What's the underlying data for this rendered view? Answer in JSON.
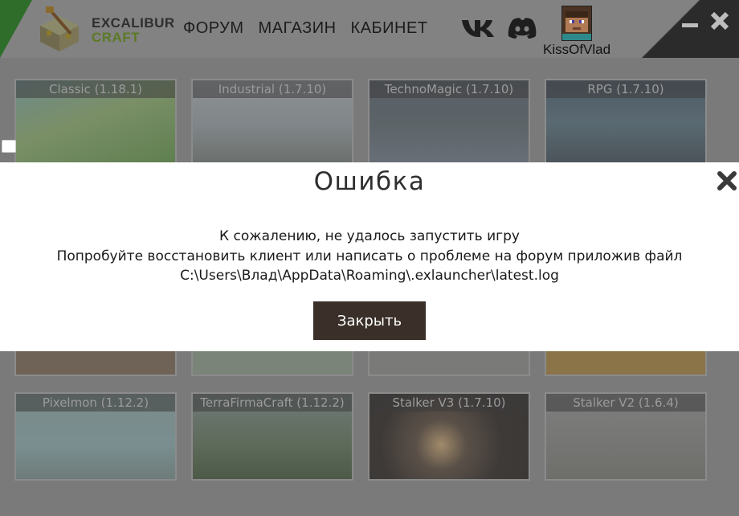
{
  "app": {
    "logo": {
      "line1": "EXCALIBUR",
      "line2": "CRAFT"
    },
    "nav": [
      "ФОРУМ",
      "МАГАЗИН",
      "КАБИНЕТ"
    ],
    "social": [
      "vk-icon",
      "discord-icon"
    ],
    "user": {
      "name": "KissOfVlad"
    },
    "window_controls": [
      "minimize-icon",
      "close-icon"
    ]
  },
  "servers": {
    "row1": [
      {
        "title": "Classic (1.18.1)"
      },
      {
        "title": "Industrial (1.7.10)"
      },
      {
        "title": "TechnoMagic (1.7.10)"
      },
      {
        "title": "RPG (1.7.10)"
      }
    ],
    "row3": [
      {
        "title": "Pixelmon (1.12.2)"
      },
      {
        "title": "TerraFirmaCraft (1.12.2)"
      },
      {
        "title": "Stalker V3 (1.7.10)"
      },
      {
        "title": "Stalker V2 (1.6.4)"
      }
    ]
  },
  "dialog": {
    "title": "Ошибка",
    "message": {
      "line1": "К сожалению, не удалось запустить игру",
      "line2": "Попробуйте восстановить клиент или написать о проблеме на форум приложив файл",
      "line3": "C:\\Users\\Влад\\AppData\\Roaming\\.exlauncher\\latest.log"
    },
    "button_label": "Закрыть"
  },
  "colors": {
    "overlay_bg": "#7a7a7a",
    "dialog_bg": "#ffffff",
    "button_bg": "#3a3029",
    "brand_green": "#5c7a26"
  }
}
